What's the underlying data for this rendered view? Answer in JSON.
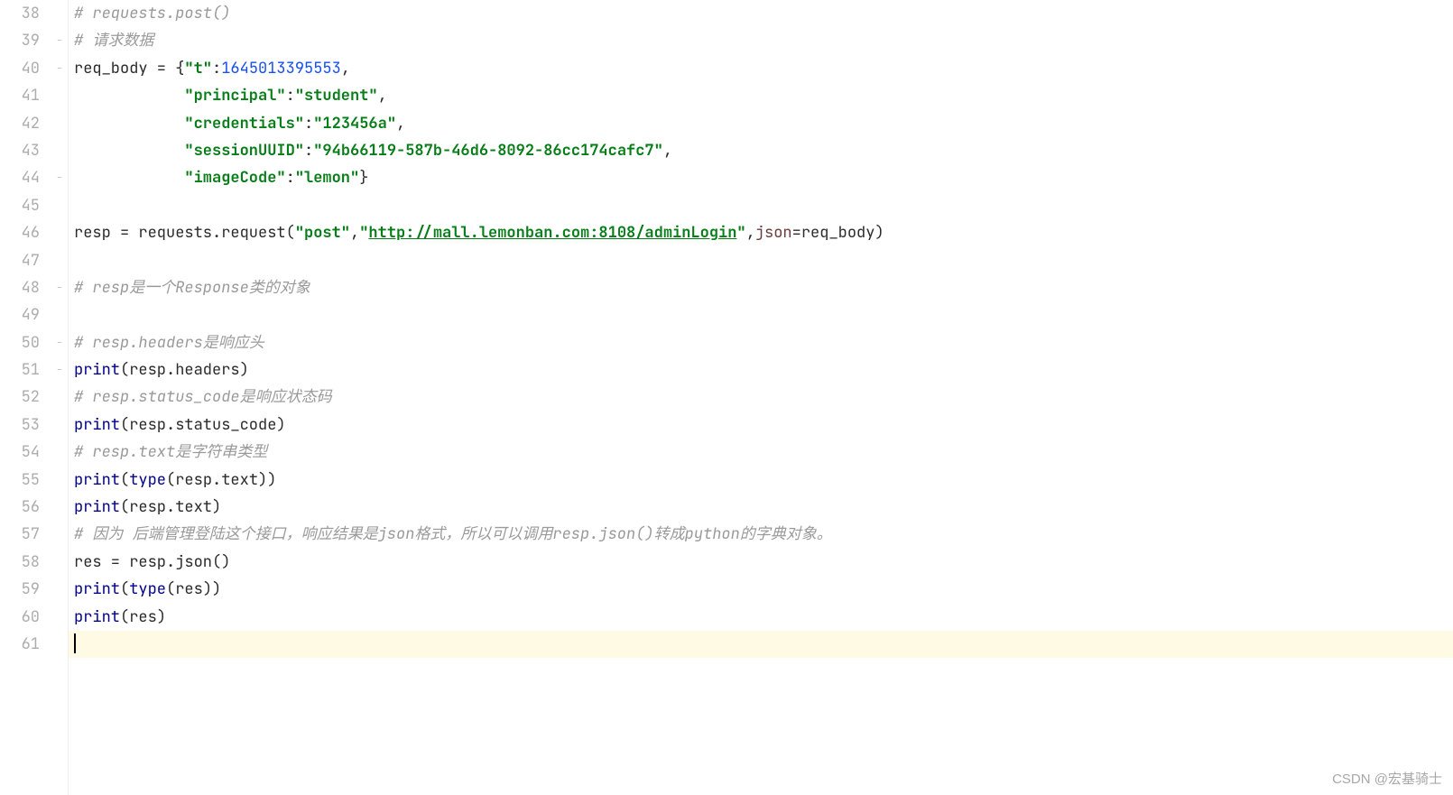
{
  "gutter": {
    "start": 38,
    "end": 61
  },
  "folds": {
    "39": "open",
    "40": "open",
    "44": "close",
    "48": "open",
    "50": "open",
    "51": "close"
  },
  "code": {
    "38": [
      {
        "cls": "tok-comment",
        "t": "# requests.post()"
      }
    ],
    "39": [
      {
        "cls": "tok-comment",
        "t": "# 请求数据"
      }
    ],
    "40": [
      {
        "cls": "tok-default",
        "t": "req_body = {"
      },
      {
        "cls": "tok-string",
        "t": "\"t\""
      },
      {
        "cls": "tok-punc",
        "t": ":"
      },
      {
        "cls": "tok-number",
        "t": "1645013395553"
      },
      {
        "cls": "tok-punc",
        "t": ","
      }
    ],
    "41": [
      {
        "cls": "tok-default",
        "t": "            "
      },
      {
        "cls": "tok-string",
        "t": "\"principal\""
      },
      {
        "cls": "tok-punc",
        "t": ":"
      },
      {
        "cls": "tok-string",
        "t": "\"student\""
      },
      {
        "cls": "tok-punc",
        "t": ","
      }
    ],
    "42": [
      {
        "cls": "tok-default",
        "t": "            "
      },
      {
        "cls": "tok-string",
        "t": "\"credentials\""
      },
      {
        "cls": "tok-punc",
        "t": ":"
      },
      {
        "cls": "tok-string",
        "t": "\"123456a\""
      },
      {
        "cls": "tok-punc",
        "t": ","
      }
    ],
    "43": [
      {
        "cls": "tok-default",
        "t": "            "
      },
      {
        "cls": "tok-string",
        "t": "\"sessionUUID\""
      },
      {
        "cls": "tok-punc",
        "t": ":"
      },
      {
        "cls": "tok-string",
        "t": "\"94b66119-587b-46d6-8092-86cc174cafc7\""
      },
      {
        "cls": "tok-punc",
        "t": ","
      }
    ],
    "44": [
      {
        "cls": "tok-default",
        "t": "            "
      },
      {
        "cls": "tok-string",
        "t": "\"imageCode\""
      },
      {
        "cls": "tok-punc",
        "t": ":"
      },
      {
        "cls": "tok-string",
        "t": "\"lemon\""
      },
      {
        "cls": "tok-punc",
        "t": "}"
      }
    ],
    "45": [],
    "46": [
      {
        "cls": "tok-default",
        "t": "resp = requests.request("
      },
      {
        "cls": "tok-string",
        "t": "\"post\""
      },
      {
        "cls": "tok-punc",
        "t": ","
      },
      {
        "cls": "tok-string",
        "t": "\""
      },
      {
        "cls": "tok-link",
        "t": "http://mall.lemonban.com:8108/adminLogin"
      },
      {
        "cls": "tok-string",
        "t": "\""
      },
      {
        "cls": "tok-punc",
        "t": ","
      },
      {
        "cls": "tok-kwarg",
        "t": "json"
      },
      {
        "cls": "tok-op",
        "t": "="
      },
      {
        "cls": "tok-default",
        "t": "req_body)"
      }
    ],
    "47": [],
    "48": [
      {
        "cls": "tok-comment",
        "t": "# resp是一个Response类的对象"
      }
    ],
    "49": [],
    "50": [
      {
        "cls": "tok-comment",
        "t": "# resp.headers是响应头"
      }
    ],
    "51": [
      {
        "cls": "tok-builtin",
        "t": "print"
      },
      {
        "cls": "tok-punc",
        "t": "("
      },
      {
        "cls": "tok-default",
        "t": "resp.headers"
      },
      {
        "cls": "tok-punc",
        "t": ")"
      }
    ],
    "52": [
      {
        "cls": "tok-comment",
        "t": "# resp.status_code是响应状态码"
      }
    ],
    "53": [
      {
        "cls": "tok-builtin",
        "t": "print"
      },
      {
        "cls": "tok-punc",
        "t": "("
      },
      {
        "cls": "tok-default",
        "t": "resp.status_code"
      },
      {
        "cls": "tok-punc",
        "t": ")"
      }
    ],
    "54": [
      {
        "cls": "tok-comment",
        "t": "# resp.text是字符串类型"
      }
    ],
    "55": [
      {
        "cls": "tok-builtin",
        "t": "print"
      },
      {
        "cls": "tok-punc",
        "t": "("
      },
      {
        "cls": "tok-builtin",
        "t": "type"
      },
      {
        "cls": "tok-punc",
        "t": "("
      },
      {
        "cls": "tok-default",
        "t": "resp.text"
      },
      {
        "cls": "tok-punc",
        "t": "))"
      }
    ],
    "56": [
      {
        "cls": "tok-builtin",
        "t": "print"
      },
      {
        "cls": "tok-punc",
        "t": "("
      },
      {
        "cls": "tok-default",
        "t": "resp.text"
      },
      {
        "cls": "tok-punc",
        "t": ")"
      }
    ],
    "57": [
      {
        "cls": "tok-comment",
        "t": "# 因为 后端管理登陆这个接口，响应结果是json格式，所以可以调用resp.json()转成python的字典对象。"
      }
    ],
    "58": [
      {
        "cls": "tok-default",
        "t": "res = resp.json()"
      }
    ],
    "59": [
      {
        "cls": "tok-builtin",
        "t": "print"
      },
      {
        "cls": "tok-punc",
        "t": "("
      },
      {
        "cls": "tok-builtin",
        "t": "type"
      },
      {
        "cls": "tok-punc",
        "t": "("
      },
      {
        "cls": "tok-default",
        "t": "res"
      },
      {
        "cls": "tok-punc",
        "t": "))"
      }
    ],
    "60": [
      {
        "cls": "tok-builtin",
        "t": "print"
      },
      {
        "cls": "tok-punc",
        "t": "("
      },
      {
        "cls": "tok-default",
        "t": "res"
      },
      {
        "cls": "tok-punc",
        "t": ")"
      }
    ],
    "61": []
  },
  "current_line": 61,
  "watermark": "CSDN @宏基骑士"
}
